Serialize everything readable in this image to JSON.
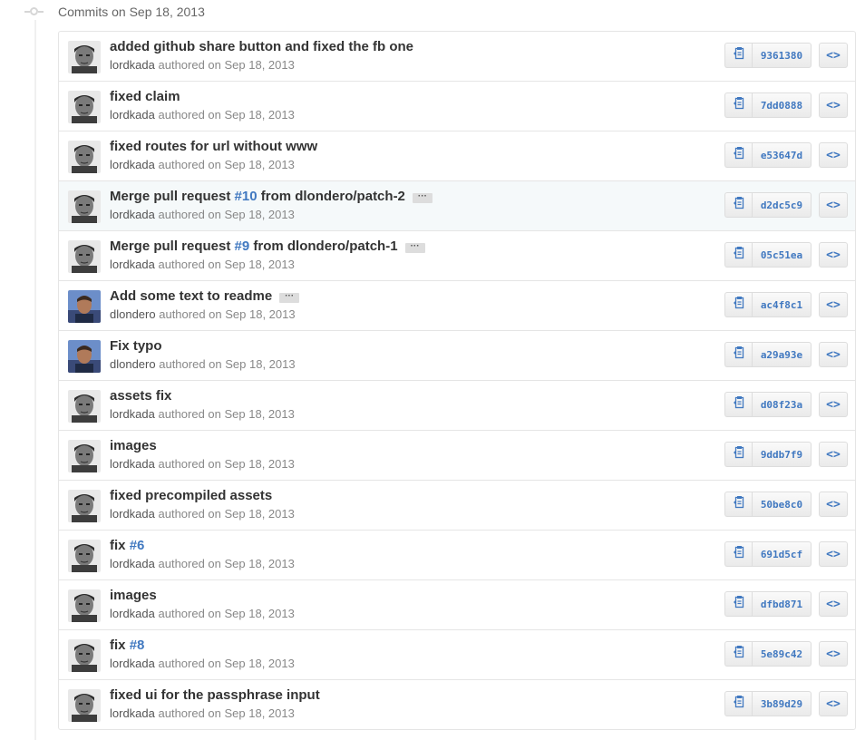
{
  "group": {
    "title": "Commits on Sep 18, 2013"
  },
  "commits": [
    {
      "message": "added github share button and fixed the fb one",
      "issue": "",
      "suffix": "",
      "expandable": false,
      "author": "lordkada",
      "authored": "authored on Sep 18, 2013",
      "sha": "9361380",
      "avatar": "lordkada-avatar"
    },
    {
      "message": "fixed claim",
      "issue": "",
      "suffix": "",
      "expandable": false,
      "author": "lordkada",
      "authored": "authored on Sep 18, 2013",
      "sha": "7dd0888",
      "avatar": "lordkada-avatar"
    },
    {
      "message": "fixed routes for url without www",
      "issue": "",
      "suffix": "",
      "expandable": false,
      "author": "lordkada",
      "authored": "authored on Sep 18, 2013",
      "sha": "e53647d",
      "avatar": "lordkada-avatar"
    },
    {
      "message": "Merge pull request ",
      "issue": "#10",
      "suffix": " from dlondero/patch-2",
      "expandable": true,
      "author": "lordkada",
      "authored": "authored on Sep 18, 2013",
      "sha": "d2dc5c9",
      "avatar": "lordkada-avatar",
      "highlight": true
    },
    {
      "message": "Merge pull request ",
      "issue": "#9",
      "suffix": " from dlondero/patch-1",
      "expandable": true,
      "author": "lordkada",
      "authored": "authored on Sep 18, 2013",
      "sha": "05c51ea",
      "avatar": "lordkada-avatar"
    },
    {
      "message": "Add some text to readme",
      "issue": "",
      "suffix": "",
      "expandable": true,
      "author": "dlondero",
      "authored": "authored on Sep 18, 2013",
      "sha": "ac4f8c1",
      "avatar": "dlondero-avatar"
    },
    {
      "message": "Fix typo",
      "issue": "",
      "suffix": "",
      "expandable": false,
      "author": "dlondero",
      "authored": "authored on Sep 18, 2013",
      "sha": "a29a93e",
      "avatar": "dlondero-avatar"
    },
    {
      "message": "assets fix",
      "issue": "",
      "suffix": "",
      "expandable": false,
      "author": "lordkada",
      "authored": "authored on Sep 18, 2013",
      "sha": "d08f23a",
      "avatar": "lordkada-avatar"
    },
    {
      "message": "images",
      "issue": "",
      "suffix": "",
      "expandable": false,
      "author": "lordkada",
      "authored": "authored on Sep 18, 2013",
      "sha": "9ddb7f9",
      "avatar": "lordkada-avatar"
    },
    {
      "message": "fixed precompiled assets",
      "issue": "",
      "suffix": "",
      "expandable": false,
      "author": "lordkada",
      "authored": "authored on Sep 18, 2013",
      "sha": "50be8c0",
      "avatar": "lordkada-avatar"
    },
    {
      "message": "fix ",
      "issue": "#6",
      "suffix": "",
      "expandable": false,
      "author": "lordkada",
      "authored": "authored on Sep 18, 2013",
      "sha": "691d5cf",
      "avatar": "lordkada-avatar"
    },
    {
      "message": "images",
      "issue": "",
      "suffix": "",
      "expandable": false,
      "author": "lordkada",
      "authored": "authored on Sep 18, 2013",
      "sha": "dfbd871",
      "avatar": "lordkada-avatar"
    },
    {
      "message": "fix ",
      "issue": "#8",
      "suffix": "",
      "expandable": false,
      "author": "lordkada",
      "authored": "authored on Sep 18, 2013",
      "sha": "5e89c42",
      "avatar": "lordkada-avatar"
    },
    {
      "message": "fixed ui for the passphrase input",
      "issue": "",
      "suffix": "",
      "expandable": false,
      "author": "lordkada",
      "authored": "authored on Sep 18, 2013",
      "sha": "3b89d29",
      "avatar": "lordkada-avatar"
    }
  ],
  "ellipsis_text": "···",
  "browse_text": "<>",
  "colors": {
    "link": "#4078c0",
    "border": "#e5e5e5",
    "highlight_row": "#f5f9fa"
  }
}
